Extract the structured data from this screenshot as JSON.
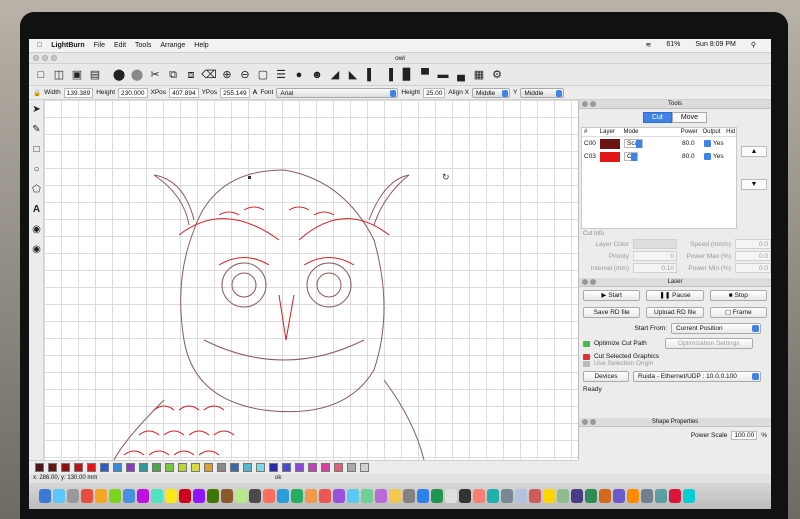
{
  "menubar": {
    "app": "LightBurn",
    "items": [
      "File",
      "Edit",
      "Tools",
      "Arrange",
      "Help"
    ],
    "battery": "61%",
    "clock": "Sun 8:09 PM"
  },
  "window": {
    "title": "owl"
  },
  "propbar": {
    "width_label": "Width",
    "width_value": "139.389",
    "height_label": "Height",
    "height_value": "230.000",
    "xpos_label": "XPos",
    "xpos_value": "407.894",
    "ypos_label": "YPos",
    "ypos_value": "255.149",
    "font_label": "Font",
    "font_value": "Arial",
    "fheight_label": "Height",
    "fheight_value": "25.00",
    "alignx_label": "Align X",
    "alignx_value": "Middle",
    "y_label": "Y",
    "y_value": "Middle"
  },
  "tools_panel": {
    "title": "Tools",
    "tabs": [
      "Cut",
      "Move"
    ],
    "headers": [
      "#",
      "Layer",
      "Mode",
      "Power",
      "Output",
      "Hid"
    ],
    "layers": [
      {
        "id": "C00",
        "color": "#6b1414",
        "mode": "Scan",
        "power": "80.0",
        "output": "Yes"
      },
      {
        "id": "C03",
        "color": "#e01818",
        "mode": "Cut",
        "power": "80.0",
        "output": "Yes"
      }
    ],
    "cut_info_label": "Cut Info",
    "fields": {
      "layer_color": "Layer Color",
      "speed": "Speed  (mm/s)",
      "speed_value": "0.0",
      "priority": "Priority",
      "priority_value": "0",
      "power_max": "Power Max (%)",
      "power_max_value": "0.0",
      "interval": "Interval (mm)",
      "interval_value": "0.10",
      "power_min": "Power Min (%)",
      "power_min_value": "0.0"
    }
  },
  "laser_panel": {
    "title": "Laser",
    "start": "Start",
    "pause": "Pause",
    "stop": "Stop",
    "save_rd": "Save RD file",
    "upload_rd": "Upload RD file",
    "frame": "Frame",
    "start_from_label": "Start From:",
    "start_from_value": "Current Position",
    "optimize": "Optimize Cut Path",
    "opt_settings": "Optimization Settings",
    "cut_selected": "Cut Selected Graphics",
    "use_origin": "Use Selection Origin",
    "devices": "Devices",
    "device_value": "Ruida - Ethernet/UDP : 10.0.0.100",
    "status": "Ready"
  },
  "shape_panel": {
    "title": "Shape Properties",
    "power_scale_label": "Power Scale",
    "power_scale_value": "100.00",
    "unit": "%"
  },
  "statusbar": {
    "coords": "x: 286.00, y: 130.00 mm",
    "message": "ok"
  },
  "palette": [
    "#4a1818",
    "#6b1414",
    "#8b1010",
    "#c01010",
    "#e01818",
    "#2a5dc8",
    "#3a8bd8",
    "#8a3ac0",
    "#2e9a9a",
    "#4aa84a",
    "#7ac840",
    "#b8d830",
    "#d8d840",
    "#d8a030",
    "#8a8a8a",
    "#3a6aa8",
    "#58b8c8",
    "#7ad8e8",
    "#2a2aa8",
    "#4a4ad8",
    "#8a4ad8",
    "#c040c0",
    "#d840a0",
    "#e06080",
    "#a8a8a8",
    "#d0d0d0"
  ],
  "dock_colors": [
    "#3a7bd5",
    "#5ac8fa",
    "#999",
    "#e94b3c",
    "#f5a623",
    "#7ed321",
    "#4a90e2",
    "#bd10e0",
    "#50e3c2",
    "#f8e71c",
    "#d0021b",
    "#9013fe",
    "#417505",
    "#8b572a",
    "#b8e986",
    "#4a4a4a",
    "#ff6f61",
    "#2d9cdb",
    "#27ae60",
    "#f2994a",
    "#eb5757",
    "#9b51e0",
    "#56ccf2",
    "#6fcf97",
    "#bb6bd9",
    "#f2c94c",
    "#828282",
    "#2f80ed",
    "#219653",
    "#e0e0e0",
    "#333",
    "#fa8072",
    "#20b2aa",
    "#778899",
    "#b0c4de",
    "#cd5c5c",
    "#ffd700",
    "#8fbc8f",
    "#483d8b",
    "#2e8b57",
    "#d2691e",
    "#6a5acd",
    "#ff8c00",
    "#708090",
    "#5f9ea0",
    "#dc143c",
    "#00ced1"
  ]
}
